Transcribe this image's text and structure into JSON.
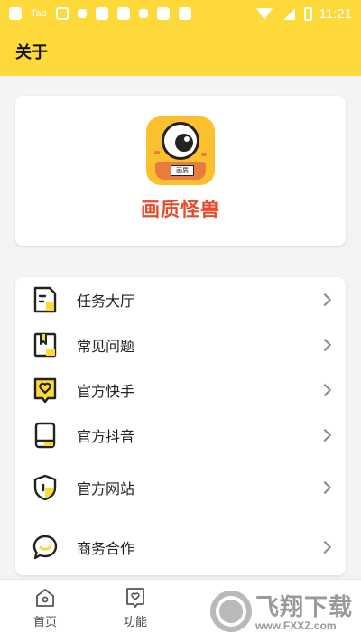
{
  "status_bar": {
    "carrier": "Tap",
    "time": "11:21"
  },
  "header": {
    "title": "关于"
  },
  "app": {
    "name": "画质怪兽",
    "icon_badge_text": "画质"
  },
  "menu": {
    "items": [
      {
        "label": "任务大厅",
        "icon": "task-icon"
      },
      {
        "label": "常见问题",
        "icon": "faq-book-icon"
      },
      {
        "label": "官方快手",
        "icon": "kuaishou-icon"
      },
      {
        "label": "官方抖音",
        "icon": "douyin-icon"
      },
      {
        "label": "官方网站",
        "icon": "website-shield-icon"
      },
      {
        "label": "商务合作",
        "icon": "business-chat-icon"
      }
    ]
  },
  "tabbar": {
    "tabs": [
      {
        "label": "首页",
        "icon": "home-icon"
      },
      {
        "label": "功能",
        "icon": "heart-bookmark-icon"
      }
    ]
  },
  "watermark": {
    "text": "飞翔下载",
    "url": "www.FXXZ.com"
  },
  "colors": {
    "accent_yellow": "#fdd93a",
    "app_name_red": "#e84b2c",
    "background": "#f4f4f4"
  }
}
